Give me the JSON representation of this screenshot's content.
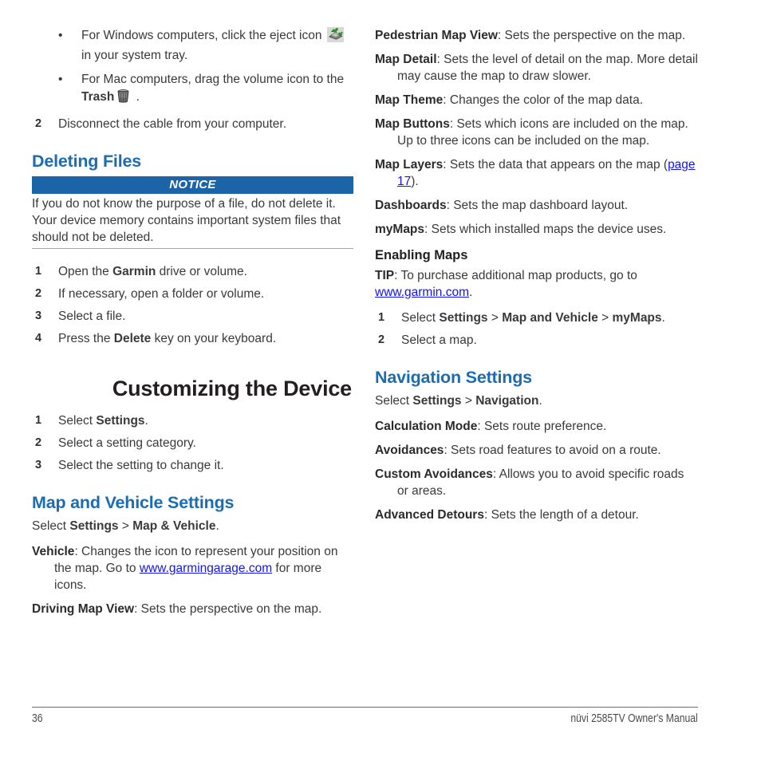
{
  "document": {
    "page_number": "36",
    "manual_title": "nüvi 2585TV Owner's Manual",
    "colors": {
      "heading_blue": "#1b6cb0",
      "notice_bar_blue": "#1c64a8",
      "link_blue": "#1414ee",
      "body_gray": "#3a3a3a"
    }
  },
  "left_column": {
    "bullets": [
      {
        "marker": "•",
        "text_before_icon": "For Windows computers, click the eject icon ",
        "icon": "eject-icon",
        "text_after_icon": " in your system tray."
      },
      {
        "marker": "•",
        "text_before_bold": "For Mac computers, drag the volume icon to the ",
        "bold": "Trash",
        "icon": "trash-icon",
        "text_after_icon": " ."
      }
    ],
    "step_disconnect": {
      "num": "2",
      "text": "Disconnect the cable from your computer."
    },
    "deleting_files": {
      "heading": "Deleting Files",
      "notice": {
        "label": "NOTICE",
        "body": "If you do not know the purpose of a file, do not delete it. Your device memory contains important system files that should not be deleted."
      },
      "steps": [
        {
          "num": "1",
          "pre": "Open the ",
          "bold": "Garmin",
          "post": " drive or volume."
        },
        {
          "num": "2",
          "pre": "If necessary, open a folder or volume.",
          "bold": "",
          "post": ""
        },
        {
          "num": "3",
          "pre": "Select a file.",
          "bold": "",
          "post": ""
        },
        {
          "num": "4",
          "pre": "Press the ",
          "bold": "Delete",
          "post": " key on your keyboard."
        }
      ]
    },
    "customizing": {
      "chapter_heading": "Customizing the Device",
      "steps": [
        {
          "num": "1",
          "pre": "Select ",
          "bold": "Settings",
          "post": "."
        },
        {
          "num": "2",
          "pre": "Select a setting category.",
          "bold": "",
          "post": ""
        },
        {
          "num": "3",
          "pre": "Select the setting to change it.",
          "bold": "",
          "post": ""
        }
      ]
    },
    "map_and_vehicle": {
      "heading": "Map and Vehicle Settings",
      "select_path": {
        "pre": "Select ",
        "b1": "Settings",
        "mid": " > ",
        "b2": "Map & Vehicle",
        "post": "."
      },
      "items": [
        {
          "term": "Vehicle",
          "desc_before_link": ": Changes the icon to represent your position on the map. Go to ",
          "link": "www.garmingarage.com",
          "desc_after_link": " for more icons."
        },
        {
          "term": "Driving Map View",
          "desc_before_link": ": Sets the perspective on the map.",
          "link": "",
          "desc_after_link": ""
        }
      ]
    }
  },
  "right_column": {
    "map_items": [
      {
        "term": "Pedestrian Map View",
        "desc": ": Sets the perspective on the map."
      },
      {
        "term": "Map Detail",
        "desc": ": Sets the level of detail on the map. More detail may cause the map to draw slower."
      },
      {
        "term": "Map Theme",
        "desc": ": Changes the color of the map data."
      },
      {
        "term": "Map Buttons",
        "desc": ": Sets which icons are included on the map. Up to three icons can be included on the map."
      }
    ],
    "map_layers": {
      "term": "Map Layers",
      "desc_before_ref": ": Sets the data that appears on the map (",
      "ref": "page 17",
      "desc_after_ref": ")."
    },
    "map_items_after": [
      {
        "term": "Dashboards",
        "desc": ": Sets the map dashboard layout."
      },
      {
        "term": "myMaps",
        "desc": ": Sets which installed maps the device uses."
      }
    ],
    "enabling_maps": {
      "heading": "Enabling Maps",
      "tip": {
        "label": "TIP",
        "text_before_link": ": To purchase additional map products, go to ",
        "link": "www.garmin.com",
        "text_after_link": "."
      },
      "steps": [
        {
          "num": "1",
          "pre": "Select ",
          "b1": "Settings",
          "mid": " > ",
          "b2": "Map and Vehicle",
          "mid2": " > ",
          "b3": "myMaps",
          "post": "."
        },
        {
          "num": "2",
          "pre": "Select a map.",
          "b1": "",
          "mid": "",
          "b2": "",
          "mid2": "",
          "b3": "",
          "post": ""
        }
      ]
    },
    "navigation_settings": {
      "heading": "Navigation Settings",
      "select_path": {
        "pre": "Select ",
        "b1": "Settings",
        "mid": " > ",
        "b2": "Navigation",
        "post": "."
      },
      "items": [
        {
          "term": "Calculation Mode",
          "desc": ": Sets route preference."
        },
        {
          "term": "Avoidances",
          "desc": ": Sets road features to avoid on a route."
        },
        {
          "term": "Custom Avoidances",
          "desc": ": Allows you to avoid specific roads or areas."
        },
        {
          "term": "Advanced Detours",
          "desc": ": Sets the length of a detour."
        }
      ]
    }
  }
}
